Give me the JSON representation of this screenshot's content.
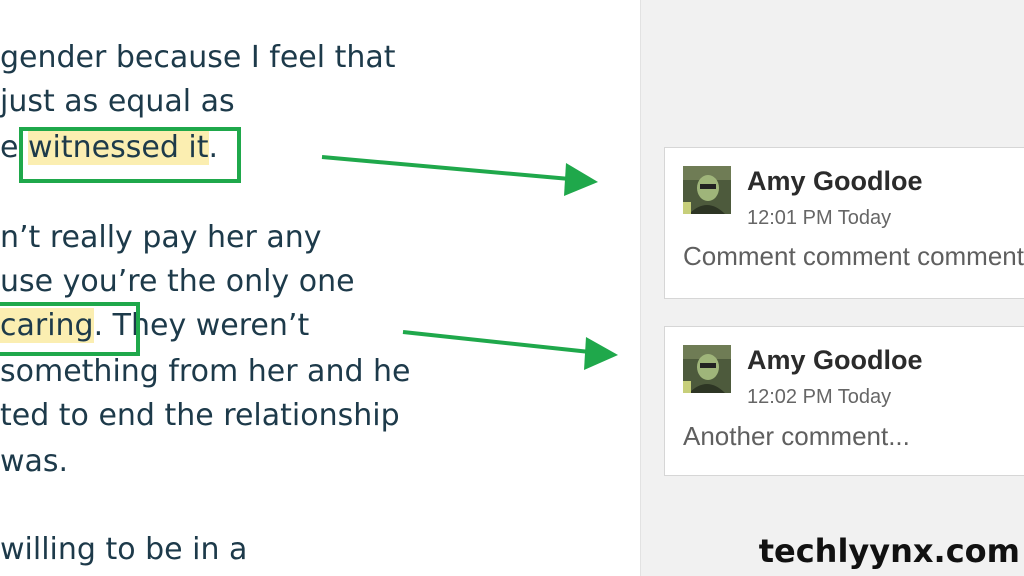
{
  "document": {
    "lines": [
      "gender because I feel that",
      "just as equal as",
      "witnessed it",
      "n’t really pay her any",
      "use you’re the only one",
      "caring",
      "something from her and he",
      "ted to end the relationship",
      "was.",
      "willing to be in a"
    ],
    "line3_prefix": "e ",
    "line3_suffix": ".",
    "line6_suffix": ". They weren’t"
  },
  "comments": [
    {
      "author": "Amy Goodloe",
      "time": "12:01 PM Today",
      "text": "Comment comment comment"
    },
    {
      "author": "Amy Goodloe",
      "time": "12:02 PM Today",
      "text": "Another comment..."
    }
  ],
  "watermark": "techlyynx.com",
  "colors": {
    "highlight": "#fbeeb1",
    "annotation_green": "#1fa84b",
    "text": "#1d3a4a",
    "sidebar": "#f1f1f1"
  }
}
